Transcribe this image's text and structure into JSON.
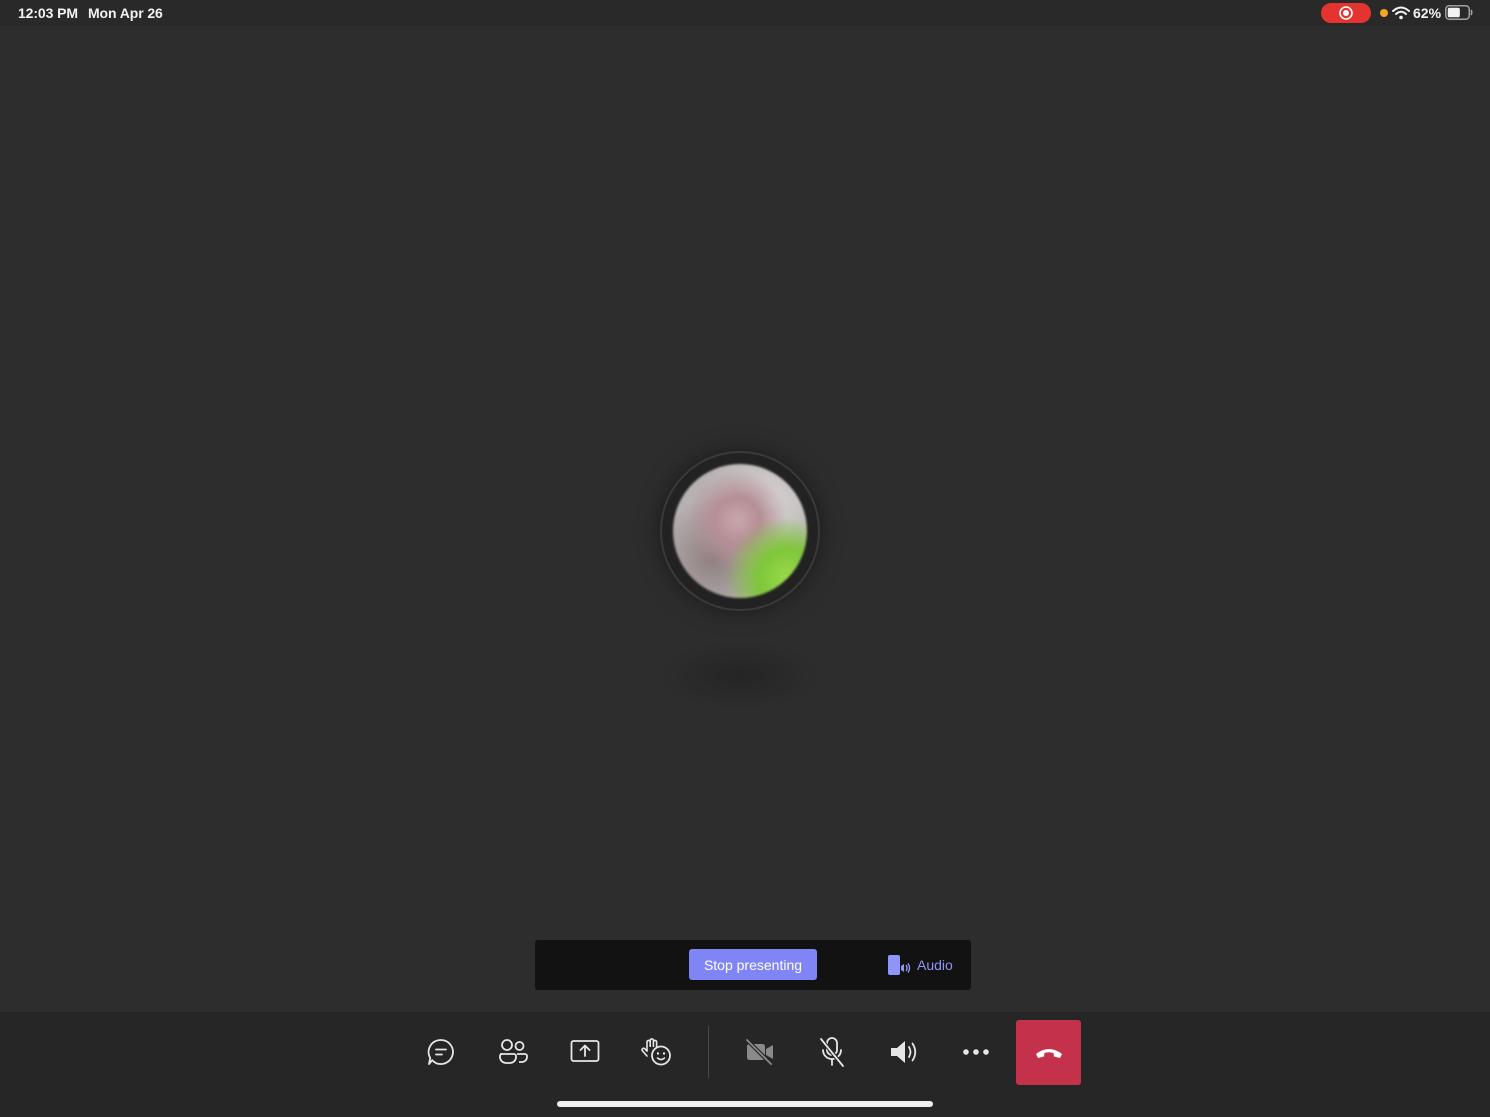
{
  "status_bar": {
    "time": "12:03 PM",
    "date": "Mon Apr 26",
    "battery_percent": "62%",
    "battery_level": 0.62,
    "recording_active": true,
    "colors": {
      "recording_pill": "#e5342f",
      "mic_indicator": "#f5a623"
    }
  },
  "stage": {
    "participant_avatar": {
      "icon": "participant-avatar-blurred-photo"
    }
  },
  "presenting_bar": {
    "stop_label": "Stop presenting",
    "audio_label": "Audio",
    "audio_icon": "phone-speaker-icon",
    "colors": {
      "stop_button": "#7f85f5",
      "audio_text": "#8f95f7"
    }
  },
  "toolbar": {
    "buttons": [
      {
        "name": "chat",
        "icon": "chat-bubble-icon"
      },
      {
        "name": "participants",
        "icon": "people-icon"
      },
      {
        "name": "share",
        "icon": "share-screen-icon"
      },
      {
        "name": "reactions",
        "icon": "raise-hand-emoji-icon"
      },
      {
        "name": "camera",
        "icon": "video-off-icon"
      },
      {
        "name": "microphone",
        "icon": "mic-off-icon"
      },
      {
        "name": "speaker",
        "icon": "speaker-icon"
      },
      {
        "name": "more",
        "icon": "more-horizontal-icon"
      },
      {
        "name": "hang-up",
        "icon": "hang-up-phone-icon"
      }
    ],
    "colors": {
      "hang_up": "#c4314b"
    }
  }
}
